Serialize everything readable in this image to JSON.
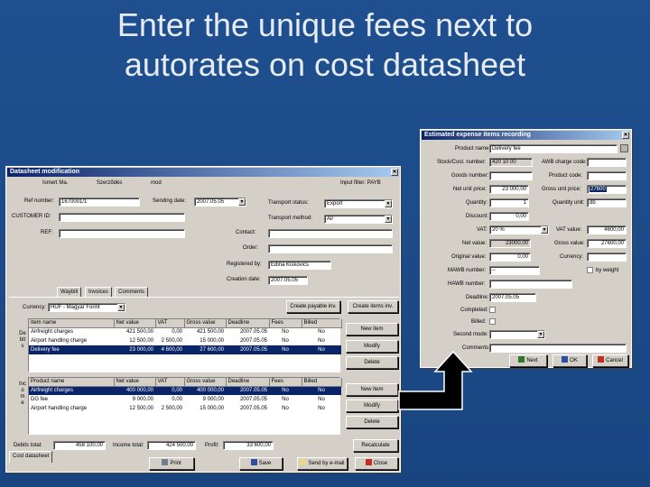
{
  "slide": {
    "title_line1": "Enter the unique fees next to",
    "title_line2": "autorates on cost datasheet"
  },
  "datasheet": {
    "window_title": "Datasheet modification",
    "close_glyph": "✕",
    "header_row": [
      "Ismert Ma.",
      "Szerződés",
      "mod",
      "Input filter: PAYB"
    ],
    "fields": {
      "ref_number_label": "Ref number:",
      "ref_number_value": "1670001/1",
      "sending_date_label": "Sending date:",
      "sending_date_value": "2007.05.05",
      "transport_status_label": "Transport status:",
      "transport_status_value": "Export",
      "transport_method_label": "Transport method:",
      "transport_method_value": "Air",
      "customer_label": "CUSTOMER ID:",
      "customer_value": "",
      "ref_label": "REF:",
      "ref_value": "",
      "contact_label": "Contact:",
      "contact_value": "",
      "order_label": "Order:",
      "order_value": "",
      "registered_by_label": "Registered by:",
      "registered_by_value": "Edina Kiskovics",
      "creation_date_label": "Creation date:",
      "creation_date_value": "2007.05.05"
    },
    "tabs": [
      "Cost datasheet",
      "Waybill",
      "Invoices",
      "Comments"
    ],
    "currency_label": "Currency:",
    "currency_value": "HUF - Magyar Forint",
    "create_payable_button": "Create payable inv.",
    "create_items_button": "Create items inv.",
    "income_side_label": "Debits",
    "cost_side_label": "Income",
    "income_table": {
      "columns": [
        "Item name",
        "Net value",
        "VAT",
        "Gross value",
        "Deadline",
        "Fees",
        "Billed"
      ],
      "rows": [
        [
          "Airfreight charges",
          "421 500,00",
          "0,00",
          "421 500,00",
          "2007.05.05",
          "No",
          "No"
        ],
        [
          "Airport handling charge",
          "12 500,00",
          "2 500,00",
          "15 000,00",
          "2007.05.05",
          "No",
          "No"
        ],
        [
          "Delivery fee",
          "23 000,00",
          "4 600,00",
          "27 600,00",
          "2007.05.05",
          "No",
          "No"
        ]
      ],
      "selected_row": 2
    },
    "cost_table": {
      "columns": [
        "Product name",
        "Net value",
        "VAT",
        "Gross value",
        "Deadline",
        "Fees",
        "Billed"
      ],
      "rows": [
        [
          "Airfreight charges",
          "400 000,00",
          "0,00",
          "400 000,00",
          "2007.05.05",
          "No",
          "No"
        ],
        [
          "DG fee",
          "9 000,00",
          "0,00",
          "9 000,00",
          "2007.05.05",
          "No",
          "No"
        ],
        [
          "Airport handling charge",
          "12 500,00",
          "2 500,00",
          "15 000,00",
          "2007.05.05",
          "No",
          "No"
        ]
      ],
      "selected_row": 0
    },
    "side_buttons": [
      "New item",
      "Modify",
      "Delete",
      "New item",
      "Modify",
      "Delete"
    ],
    "totals": {
      "income_label": "Debits total:",
      "income_value": "458 100,00",
      "cost_label": "Income total:",
      "cost_value": "424 500,00",
      "profit_label": "Profit:",
      "profit_value": "33 600,00"
    },
    "recalc_button": "Recalculate",
    "bottom_buttons": [
      "Print",
      "Save",
      "Send by e-mail",
      "Close"
    ]
  },
  "estimate": {
    "window_title": "Estimated expense items recording",
    "close_glyph": "✕",
    "left_fields": [
      {
        "label": "Product name:",
        "value": "Delivery fee",
        "wide": true
      },
      {
        "label": "Stock/Cost. number:",
        "value": "420 10 00",
        "gray": true
      },
      {
        "label": "Goods number:",
        "value": ""
      },
      {
        "label": "Net unit price:",
        "value": "23 000,00",
        "right": true
      },
      {
        "label": "Quantity:",
        "value": "1",
        "right": true
      },
      {
        "label": "Discount:",
        "value": "0,00",
        "right": true
      },
      {
        "label": "VAT:",
        "value": "20 %",
        "dd": true
      },
      {
        "label": "Net value:",
        "value": "23000,00",
        "right": true,
        "gray": true
      },
      {
        "label": "Original value:",
        "value": "0,00",
        "right": true
      },
      {
        "label": "MAWB number:",
        "value": "--",
        "right": true
      },
      {
        "label": "HAWB number:",
        "value": ""
      },
      {
        "label": "Deadline:",
        "value": "2007.05.05"
      },
      {
        "label": "Completed:",
        "value": ""
      },
      {
        "label": "Billed:",
        "value": ""
      },
      {
        "label": "Second mode:",
        "value": "",
        "dd": true
      },
      {
        "label": "Comments:",
        "value": "",
        "wide": true
      }
    ],
    "right_fields": [
      {
        "label": "AWB charge code:",
        "value": ""
      },
      {
        "label": "Product code:",
        "value": ""
      },
      {
        "label": "Gross unit price:",
        "value": "27600",
        "highlight": true
      },
      {
        "label": "Quantity unit:",
        "value": "db"
      },
      {
        "label": "VAT value:",
        "value": "4600,00"
      },
      {
        "label": "Gross value:",
        "value": "27600,00"
      },
      {
        "label": "Currency:",
        "value": ""
      }
    ],
    "by_weight_label": "by weight",
    "bottom_buttons": [
      "Next",
      "OK",
      "Cancel"
    ]
  },
  "colors": {
    "background": "#1f4f8e",
    "window": "#d4d0c8",
    "titlebar": "#0a246a",
    "selection": "#0a246a"
  }
}
